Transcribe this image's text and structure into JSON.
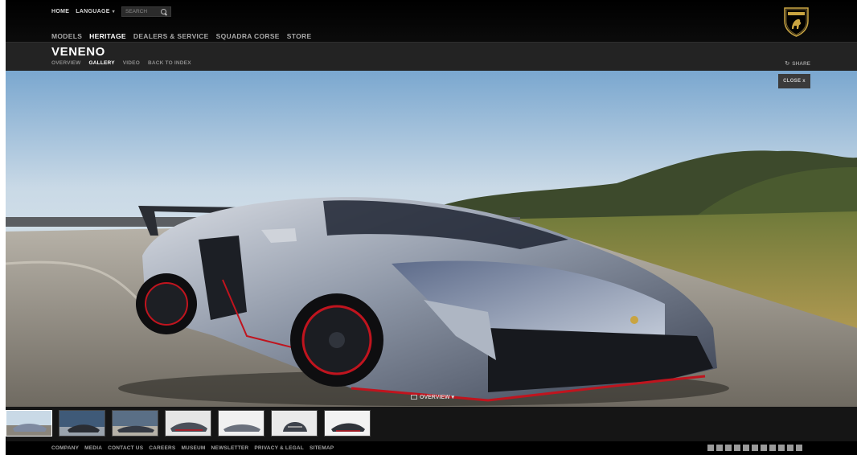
{
  "utility": {
    "home": "HOME",
    "language": "LANGUAGE",
    "language_caret": "▾",
    "search_placeholder": "SEARCH"
  },
  "main_nav": [
    "MODELS",
    "HERITAGE",
    "DEALERS & SERVICE",
    "SQUADRA CORSE",
    "STORE"
  ],
  "main_nav_active": "HERITAGE",
  "page_title": "VENENO",
  "sub_nav": [
    "OVERVIEW",
    "GALLERY",
    "VIDEO",
    "BACK TO INDEX"
  ],
  "sub_nav_active": "GALLERY",
  "share_label": "SHARE",
  "close_label": "CLOSE x",
  "overview_toggle": "OVERVIEW ▾",
  "thumbnails_count": 7,
  "thumbnails_active_index": 0,
  "footer_links": [
    "COMPANY",
    "MEDIA",
    "CONTACT US",
    "CAREERS",
    "MUSEUM",
    "NEWSLETTER",
    "PRIVACY & LEGAL",
    "SITEMAP"
  ],
  "social_icons": [
    "facebook-icon",
    "google-plus-icon",
    "twitter-icon",
    "youtube-icon",
    "instagram-icon",
    "weibo-icon",
    "linkedin-icon",
    "foursquare-icon",
    "wechat-icon",
    "tumblr-icon",
    "rss-icon"
  ],
  "colors": {
    "background": "#000000",
    "subheader": "#232323",
    "active_text": "#ffffff",
    "inactive_text": "#a9a9a9",
    "accent_red": "#c0141e"
  }
}
